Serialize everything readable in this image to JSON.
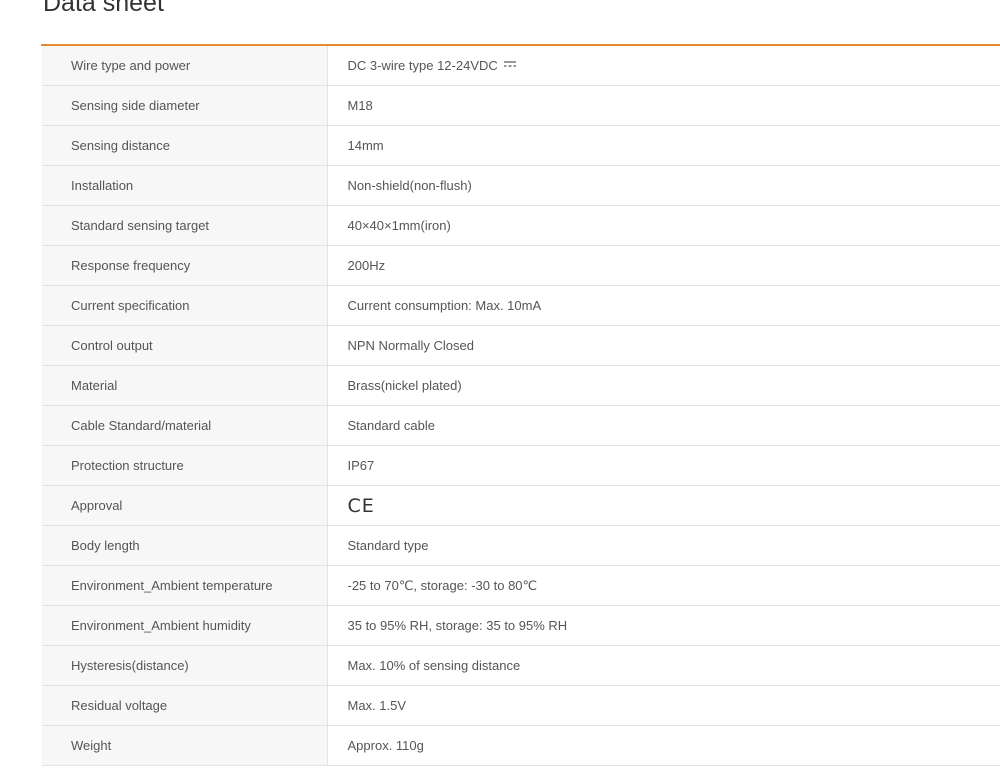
{
  "title": "Data sheet",
  "colors": {
    "accent": "#e58a2f",
    "label_bg": "#f7f7f7",
    "border": "#e3e3e3",
    "text": "#555555"
  },
  "rows": [
    {
      "label": "Wire type and power",
      "value": "DC 3-wire type 12-24VDC",
      "icon": "dc-symbol-icon"
    },
    {
      "label": "Sensing side diameter",
      "value": "M18"
    },
    {
      "label": "Sensing distance",
      "value": "14mm"
    },
    {
      "label": "Installation",
      "value": "Non-shield(non-flush)"
    },
    {
      "label": "Standard sensing target",
      "value": "40×40×1mm(iron)"
    },
    {
      "label": "Response frequency",
      "value": "200Hz"
    },
    {
      "label": "Current specification",
      "value": "Current consumption: Max. 10mA"
    },
    {
      "label": "Control output",
      "value": "NPN Normally Closed"
    },
    {
      "label": "Material",
      "value": "Brass(nickel plated)"
    },
    {
      "label": "Cable Standard/material",
      "value": "Standard cable"
    },
    {
      "label": "Protection structure",
      "value": "IP67"
    },
    {
      "label": "Approval",
      "value": "CE",
      "icon": "ce-mark-icon"
    },
    {
      "label": "Body length",
      "value": "Standard type"
    },
    {
      "label": "Environment_Ambient temperature",
      "value": "-25 to 70℃, storage: -30 to 80℃"
    },
    {
      "label": "Environment_Ambient humidity",
      "value": "35 to 95% RH, storage: 35 to 95% RH"
    },
    {
      "label": "Hysteresis(distance)",
      "value": "Max. 10% of sensing distance"
    },
    {
      "label": "Residual voltage",
      "value": "Max. 1.5V"
    },
    {
      "label": "Weight",
      "value": "Approx. 110g"
    }
  ]
}
